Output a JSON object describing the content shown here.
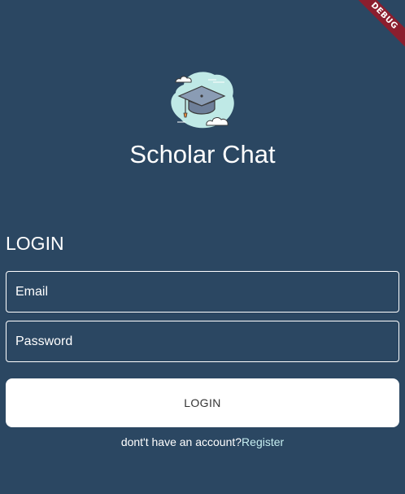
{
  "debug_banner": {
    "label": "DEBUG"
  },
  "app": {
    "title": "Scholar Chat"
  },
  "login": {
    "heading": "LOGIN",
    "email_placeholder": "Email",
    "password_placeholder": "Password",
    "button_label": "LOGIN",
    "register_prompt": "dont't have an account?",
    "register_link": "Register"
  },
  "colors": {
    "background": "#2b4762",
    "text": "#ffffff",
    "link": "#c6eef0",
    "debug_ribbon": "#8b1e2e"
  },
  "icons": {
    "logo": "graduation-cap-logo-icon"
  }
}
